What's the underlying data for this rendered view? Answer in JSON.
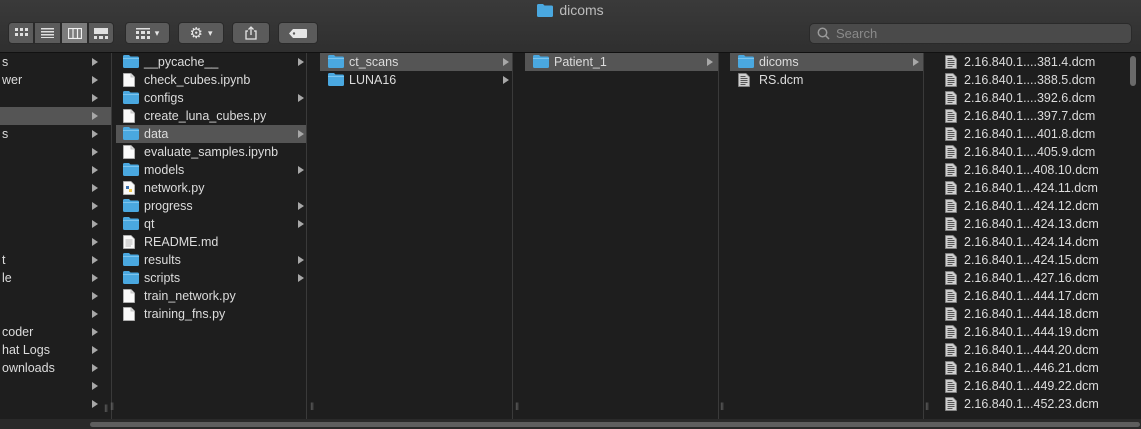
{
  "window": {
    "title": "dicoms"
  },
  "search": {
    "placeholder": "Search"
  },
  "sidebar": {
    "items": [
      {
        "label": "s",
        "chev": true
      },
      {
        "label": "wer",
        "chev": true
      },
      {
        "label": "",
        "chev": true
      },
      {
        "label": "",
        "chev": true,
        "selected": true
      },
      {
        "label": "s",
        "chev": true
      },
      {
        "label": "",
        "chev": true
      },
      {
        "label": "",
        "chev": true
      },
      {
        "label": "",
        "chev": true
      },
      {
        "label": "",
        "chev": true
      },
      {
        "label": "",
        "chev": true
      },
      {
        "label": "",
        "chev": true
      },
      {
        "label": "t",
        "chev": true
      },
      {
        "label": "le",
        "chev": true
      },
      {
        "label": "",
        "chev": true
      },
      {
        "label": "",
        "chev": true
      },
      {
        "label": "coder",
        "chev": true
      },
      {
        "label": "hat Logs",
        "chev": true
      },
      {
        "label": "ownloads",
        "chev": true
      },
      {
        "label": "",
        "chev": true
      },
      {
        "label": "",
        "chev": true
      }
    ]
  },
  "column1": {
    "items": [
      {
        "label": "__pycache__",
        "type": "folder",
        "chev": true
      },
      {
        "label": "check_cubes.ipynb",
        "type": "file",
        "chev": false
      },
      {
        "label": "configs",
        "type": "folder",
        "chev": true
      },
      {
        "label": "create_luna_cubes.py",
        "type": "file",
        "chev": false
      },
      {
        "label": "data",
        "type": "folder",
        "chev": true,
        "selected": true
      },
      {
        "label": "evaluate_samples.ipynb",
        "type": "file",
        "chev": false
      },
      {
        "label": "models",
        "type": "folder",
        "chev": true
      },
      {
        "label": "network.py",
        "type": "python",
        "chev": false
      },
      {
        "label": "progress",
        "type": "folder",
        "chev": true
      },
      {
        "label": "qt",
        "type": "folder",
        "chev": true
      },
      {
        "label": "README.md",
        "type": "doc",
        "chev": false
      },
      {
        "label": "results",
        "type": "folder",
        "chev": true
      },
      {
        "label": "scripts",
        "type": "folder",
        "chev": true
      },
      {
        "label": "train_network.py",
        "type": "file",
        "chev": false
      },
      {
        "label": "training_fns.py",
        "type": "file",
        "chev": false
      }
    ]
  },
  "column2": {
    "items": [
      {
        "label": "ct_scans",
        "type": "folder",
        "chev": true,
        "selected": true
      },
      {
        "label": "LUNA16",
        "type": "folder",
        "chev": true
      }
    ]
  },
  "column3": {
    "items": [
      {
        "label": "Patient_1",
        "type": "folder",
        "chev": true,
        "selected": true
      }
    ]
  },
  "column4": {
    "items": [
      {
        "label": "dicoms",
        "type": "folder",
        "chev": true,
        "selected": true
      },
      {
        "label": "RS.dcm",
        "type": "dcm",
        "chev": false
      }
    ]
  },
  "column5": {
    "items": [
      {
        "label": "2.16.840.1....381.4.dcm"
      },
      {
        "label": "2.16.840.1....388.5.dcm"
      },
      {
        "label": "2.16.840.1....392.6.dcm"
      },
      {
        "label": "2.16.840.1....397.7.dcm"
      },
      {
        "label": "2.16.840.1....401.8.dcm"
      },
      {
        "label": "2.16.840.1....405.9.dcm"
      },
      {
        "label": "2.16.840.1...408.10.dcm"
      },
      {
        "label": "2.16.840.1...424.11.dcm"
      },
      {
        "label": "2.16.840.1...424.12.dcm"
      },
      {
        "label": "2.16.840.1...424.13.dcm"
      },
      {
        "label": "2.16.840.1...424.14.dcm"
      },
      {
        "label": "2.16.840.1...424.15.dcm"
      },
      {
        "label": "2.16.840.1...427.16.dcm"
      },
      {
        "label": "2.16.840.1...444.17.dcm"
      },
      {
        "label": "2.16.840.1...444.18.dcm"
      },
      {
        "label": "2.16.840.1...444.19.dcm"
      },
      {
        "label": "2.16.840.1...444.20.dcm"
      },
      {
        "label": "2.16.840.1...446.21.dcm"
      },
      {
        "label": "2.16.840.1...449.22.dcm"
      },
      {
        "label": "2.16.840.1...452.23.dcm"
      }
    ]
  },
  "colors": {
    "folder": "#4aa8e0",
    "selection": "#555555",
    "background": "#1e1e1e"
  }
}
